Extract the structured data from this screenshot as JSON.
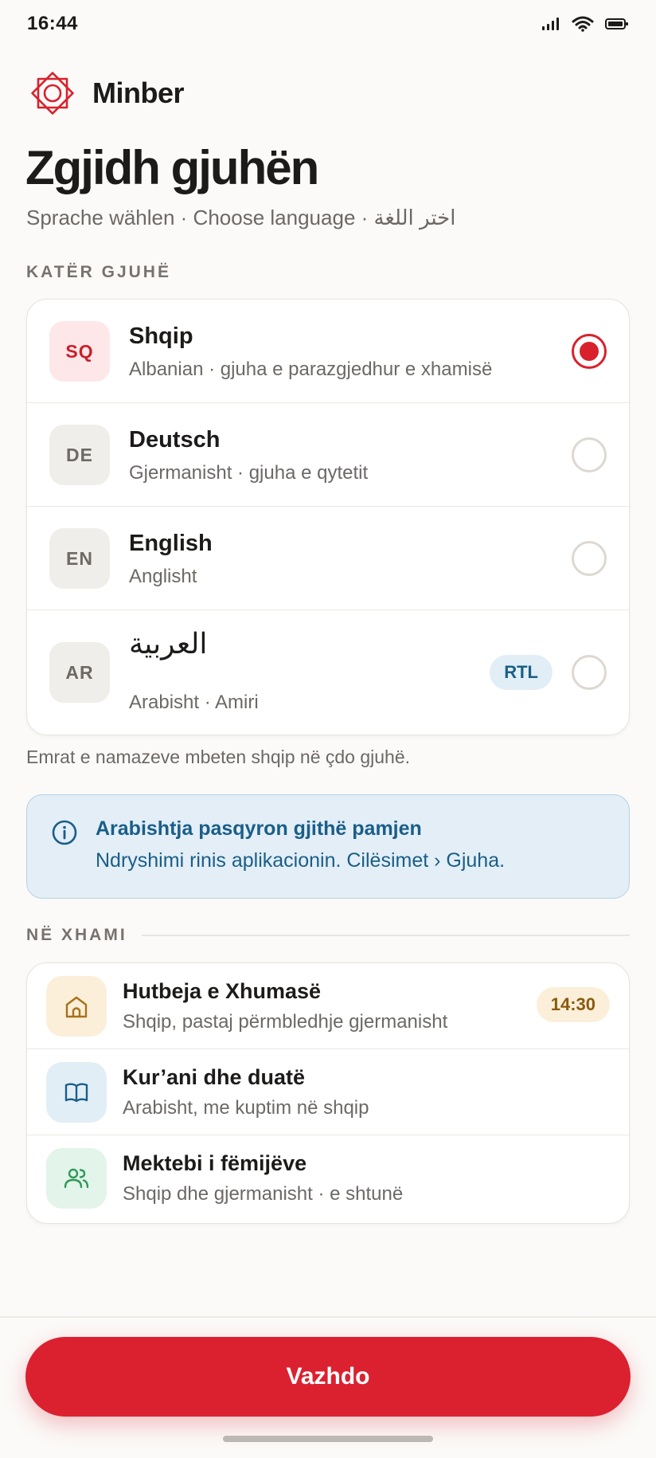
{
  "status": {
    "time": "16:44"
  },
  "brand": {
    "name": "Minber"
  },
  "title": "Zgjidh gjuhën",
  "subtitle": "Sprache wählen · Choose language · اختر اللغة",
  "languages_section": {
    "label": "KATËR GJUHË",
    "items": [
      {
        "code": "SQ",
        "name": "Shqip",
        "desc": "Albanian · gjuha e parazgjedhur e xhamisë",
        "selected": true
      },
      {
        "code": "DE",
        "name": "Deutsch",
        "desc": "Gjermanisht · gjuha e qytetit",
        "selected": false
      },
      {
        "code": "EN",
        "name": "English",
        "desc": "Anglisht",
        "selected": false
      },
      {
        "code": "AR",
        "name": "العربية",
        "desc": "Arabisht · Amiri",
        "badge": "RTL",
        "selected": false
      }
    ]
  },
  "note": "Emrat e namazeve mbeten shqip në çdo gjuhë.",
  "info": {
    "icon": "info-icon",
    "title": "Arabishtja pasqyron gjithë pamjen",
    "text": "Ndryshimi rinis aplikacionin. Cilësimet › Gjuha."
  },
  "mosque_section": {
    "label": "NË XHAMI",
    "items": [
      {
        "icon": "mosque-icon",
        "title": "Hutbeja e Xhumasë",
        "desc": "Shqip, pastaj përmbledhje gjermanisht",
        "time": "14:30"
      },
      {
        "icon": "book-icon",
        "title": "Kur’ani dhe duatë",
        "desc": "Arabisht, me kuptim në shqip"
      },
      {
        "icon": "people-icon",
        "title": "Mektebi i fëmijëve",
        "desc": "Shqip dhe gjermanisht · e shtunë"
      }
    ]
  },
  "cta": {
    "label": "Vazhdo"
  },
  "colors": {
    "accent": "#db2130",
    "info_bg": "#e3eef6",
    "info_text": "#1a5e88"
  }
}
